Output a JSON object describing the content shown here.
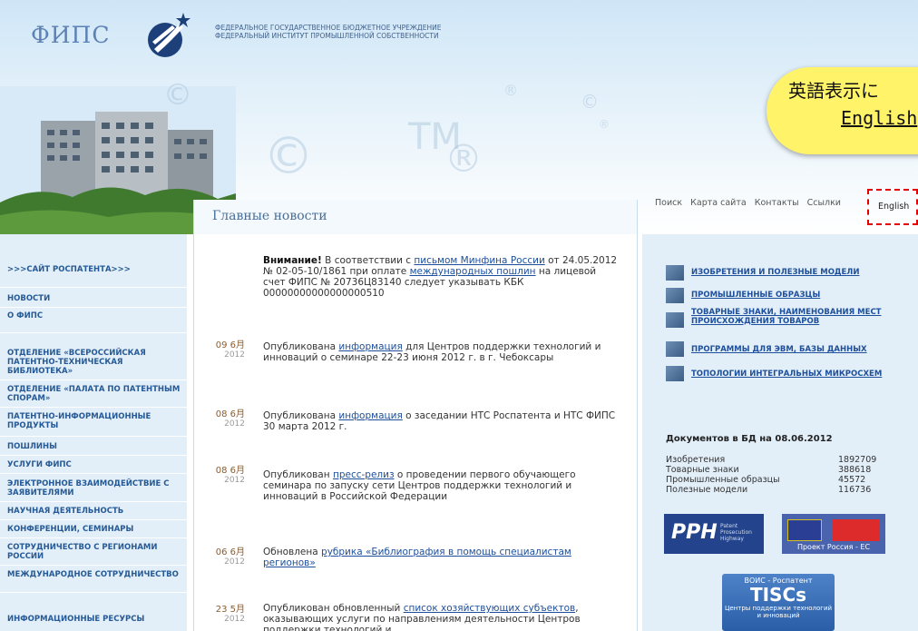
{
  "header": {
    "logo_text": "ФИПС",
    "org_line1": "ФЕДЕРАЛЬНОЕ ГОСУДАРСТВЕННОЕ БЮДЖЕТНОЕ УЧРЕЖДЕНИЕ",
    "org_line2": "ФЕДЕРАЛЬНЫЙ ИНСТИТУТ ПРОМЫШЛЕННОЙ СОБСТВЕННОСТИ",
    "watermarks": [
      "©",
      "TM",
      "®",
      "®",
      "©",
      "®",
      "©"
    ]
  },
  "callout": {
    "title": "英語表示に",
    "link": "English"
  },
  "top_nav": {
    "items": [
      "Поиск",
      "Карта сайта",
      "Контакты",
      "Ссылки"
    ],
    "english": "English"
  },
  "news_heading": "Главные новости",
  "sidebar": {
    "items": [
      ">>>САЙТ РОСПАТЕНТА>>>",
      "НОВОСТИ",
      "О ФИПС",
      "ОТДЕЛЕНИЕ «ВСЕРОССИЙСКАЯ ПАТЕНТНО-ТЕХНИЧЕСКАЯ БИБЛИОТЕКА»",
      "ОТДЕЛЕНИЕ «ПАЛАТА ПО ПАТЕНТНЫМ СПОРАМ»",
      "ПАТЕНТНО-ИНФОРМАЦИОННЫЕ ПРОДУКТЫ",
      "ПОШЛИНЫ",
      "УСЛУГИ ФИПС",
      "ЭЛЕКТРОННОЕ ВЗАИМОДЕЙСТВИЕ С ЗАЯВИТЕЛЯМИ",
      "НАУЧНАЯ ДЕЯТЕЛЬНОСТЬ",
      "КОНФЕРЕНЦИИ, СЕМИНАРЫ",
      "СОТРУДНИЧЕСТВО С РЕГИОНАМИ РОССИИ",
      "МЕЖДУНАРОДНОЕ СОТРУДНИЧЕСТВО",
      "ИНФОРМАЦИОННЫЕ РЕСУРСЫ"
    ]
  },
  "news": [
    {
      "day": "",
      "year": "",
      "bold": "Внимание!",
      "t1": " В соответствии с ",
      "l1": "письмом Минфина России",
      "t2": " от 24.05.2012 № 02-05-10/1861 при оплате ",
      "l2": "международных пошлин",
      "t3": " на лицевой счет ФИПС № 20736Ц83140 следует указывать КБК 00000000000000000510"
    },
    {
      "day": "09 6月",
      "year": "2012",
      "t1": "Опубликована ",
      "l1": "информация",
      "t2": " для Центров поддержки технологий и инноваций о семинаре 22-23 июня 2012 г. в г. Чебоксары"
    },
    {
      "day": "08 6月",
      "year": "2012",
      "t1": "Опубликована ",
      "l1": "информация",
      "t2": " о заседании НТС Роспатента и НТС ФИПС 30 марта 2012 г."
    },
    {
      "day": "08 6月",
      "year": "2012",
      "t1": "Опубликован ",
      "l1": "пресс-релиз",
      "t2": " о проведении первого обучающего семинара по запуску сети Центров поддержки технологий и инноваций в Российской Федерации"
    },
    {
      "day": "06 6月",
      "year": "2012",
      "t1": "Обновлена ",
      "l1": "рубрика «Библиография в помощь специалистам регионов»",
      "t2": ""
    },
    {
      "day": "23 5月",
      "year": "2012",
      "t1": "Опубликован обновленный ",
      "l1": "список хозяйствующих субъектов",
      "t2": ", оказывающих услуги по направлениям деятельности Центров поддержки технологий и"
    }
  ],
  "categories": [
    "ИЗОБРЕТЕНИЯ И ПОЛЕЗНЫЕ МОДЕЛИ",
    "ПРОМЫШЛЕННЫЕ ОБРАЗЦЫ",
    "ТОВАРНЫЕ ЗНАКИ, НАИМЕНОВАНИЯ МЕСТ ПРОИСХОЖДЕНИЯ ТОВАРОВ",
    "ПРОГРАММЫ ДЛЯ ЭВМ, БАЗЫ ДАННЫХ",
    "ТОПОЛОГИИ ИНТЕГРАЛЬНЫХ МИКРОСХЕМ"
  ],
  "stats": {
    "title": "Документов в БД на 08.06.2012",
    "rows": [
      {
        "label": "Изобретения",
        "value": "1892709"
      },
      {
        "label": "Товарные знаки",
        "value": "388618"
      },
      {
        "label": "Промышленные образцы",
        "value": "45572"
      },
      {
        "label": "Полезные модели",
        "value": "116736"
      }
    ]
  },
  "banners": {
    "pph_big": "PPH",
    "pph_small": "Patent Prosecution Highway",
    "eu_caption": "Проект Россия - ЕС",
    "tiscs_top": "ВОИС - Роспатент",
    "tiscs_big": "TISCs",
    "tiscs_bottom": "Центры поддержки технологий и инноваций"
  }
}
